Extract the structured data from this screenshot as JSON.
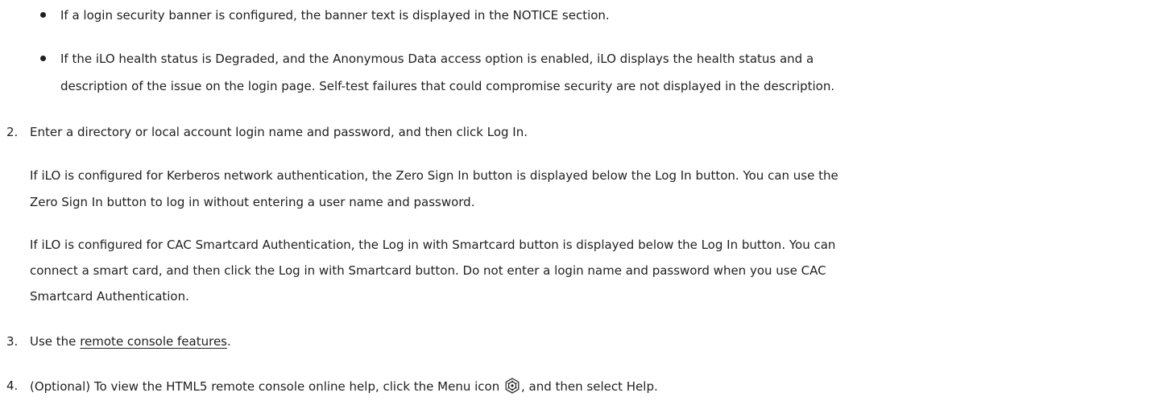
{
  "bullets": [
    {
      "lines": [
        "If a login security banner is configured, the banner text is displayed in the NOTICE section."
      ]
    },
    {
      "lines": [
        "If the iLO health status is Degraded, and the Anonymous Data access option is enabled, iLO displays the health status and a",
        "description of the issue on the login page. Self-test failures that could compromise security are not displayed in the description."
      ]
    }
  ],
  "step2": {
    "number": "2.",
    "text": "Enter a directory or local account login name and password, and then click Log In.",
    "para1": [
      "If iLO is configured for Kerberos network authentication, the Zero Sign In button is displayed below the Log In button. You can use the",
      "Zero Sign In button to log in without entering a user name and password."
    ],
    "para2": [
      "If iLO is configured for CAC Smartcard Authentication, the Log in with Smartcard button is displayed below the Log In button. You can",
      "connect a smart card, and then click the Log in with Smartcard button. Do not enter a login name and password when you use CAC",
      "Smartcard Authentication."
    ]
  },
  "step3": {
    "number": "3.",
    "prefix": "Use the",
    "link": "remote console features",
    "suffix": "."
  },
  "step4": {
    "number": "4.",
    "prefix": "(Optional) To view the HTML5 remote console online help, click the Menu icon",
    "icon": "menu-gear-icon",
    "suffix": ", and then select Help."
  }
}
